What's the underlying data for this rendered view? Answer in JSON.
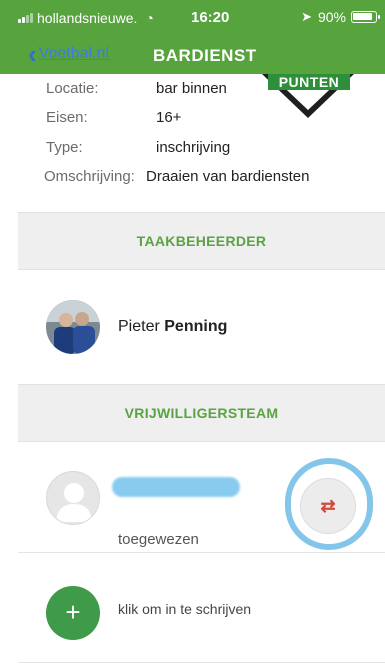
{
  "status_bar": {
    "carrier": "hollandsnieuwe.",
    "time": "16:20",
    "battery": "90%"
  },
  "nav": {
    "back_label": "Voetbal.nl",
    "title": "BARDIENST"
  },
  "badge": {
    "label": "PUNTEN"
  },
  "details": {
    "location_label": "Locatie:",
    "location_value": "bar binnen",
    "requirements_label": "Eisen:",
    "requirements_value": "16+",
    "type_label": "Type:",
    "type_value": "inschrijving",
    "description_label": "Omschrijving:",
    "description_value": "Draaien van bardiensten"
  },
  "task_manager": {
    "header": "TAAKBEHEERDER",
    "first_name": "Pieter",
    "last_name": "Penning"
  },
  "volunteer_team": {
    "header": "VRIJWILLIGERSTEAM",
    "assigned_status": "toegewezen",
    "signup_label": "klik om in te schrijven"
  },
  "colors": {
    "header_green": "#57a33d",
    "section_text_green": "#5aa343",
    "add_button_green": "#3f9a49",
    "swap_arrows_red": "#d14a3b",
    "annotation_blue": "#83c6ea"
  }
}
